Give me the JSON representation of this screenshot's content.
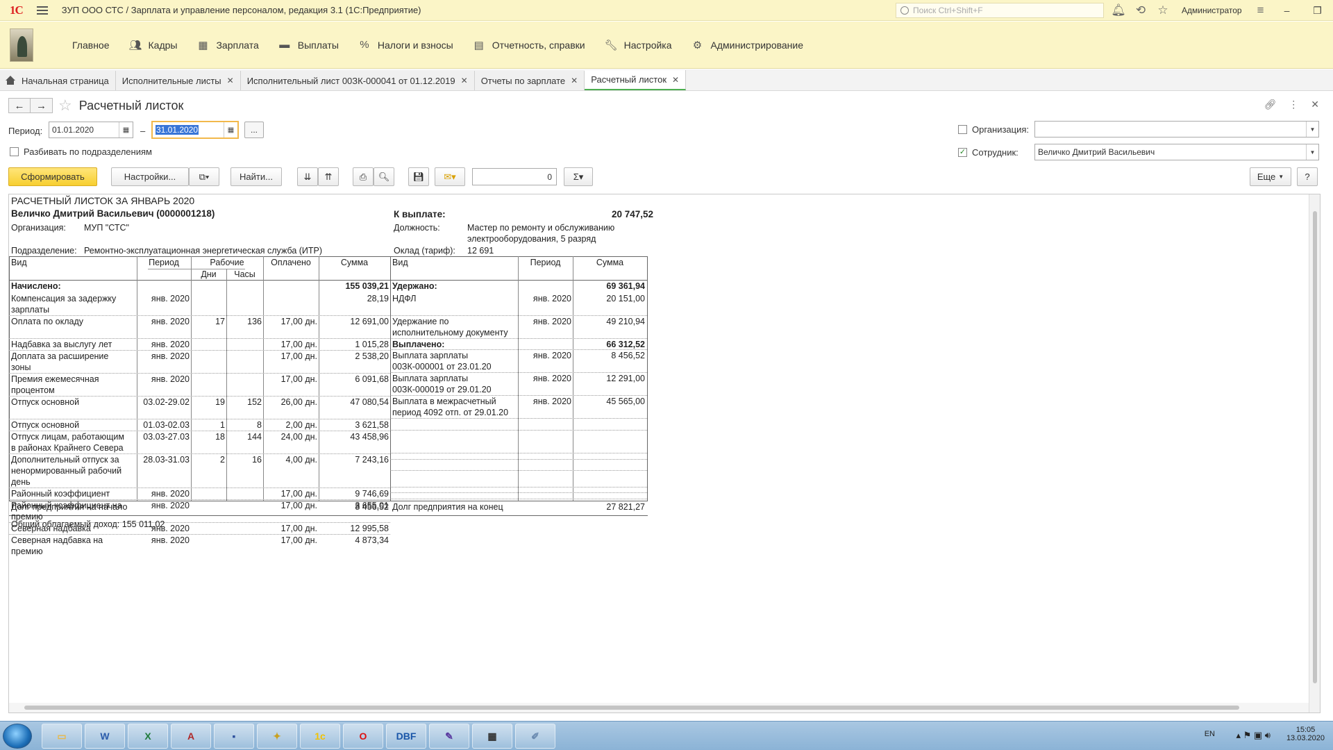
{
  "window": {
    "logo": "1С",
    "title": "ЗУП ООО СТС / Зарплата и управление персоналом, редакция 3.1  (1С:Предприятие)",
    "search_placeholder": "Поиск Ctrl+Shift+F",
    "user": "Администратор",
    "minimize": "–",
    "restore": "❐",
    "close": "✕"
  },
  "menu": {
    "items": [
      {
        "label": "Главное",
        "icon": "home-icon"
      },
      {
        "label": "Кадры",
        "icon": "people-icon"
      },
      {
        "label": "Зарплата",
        "icon": "calculator-icon"
      },
      {
        "label": "Выплаты",
        "icon": "wallet-icon"
      },
      {
        "label": "Налоги и взносы",
        "icon": "percent-icon"
      },
      {
        "label": "Отчетность, справки",
        "icon": "report-icon"
      },
      {
        "label": "Настройка",
        "icon": "wrench-icon"
      },
      {
        "label": "Администрирование",
        "icon": "gear-icon"
      }
    ]
  },
  "tabs": [
    {
      "label": "Начальная страница",
      "closable": false
    },
    {
      "label": "Исполнительные листы",
      "closable": true
    },
    {
      "label": "Исполнительный лист 00ЗК-000041 от 01.12.2019",
      "closable": true
    },
    {
      "label": "Отчеты по зарплате",
      "closable": true
    },
    {
      "label": "Расчетный листок",
      "closable": true,
      "active": true
    }
  ],
  "form": {
    "title": "Расчетный листок",
    "period_label": "Период:",
    "date_from": "01.01.2020",
    "date_to": "31.01.2020",
    "dash": "–",
    "more_button": "...",
    "split_label": "Разбивать по подразделениям",
    "org_label": "Организация:",
    "org_value": "",
    "emp_label": "Сотрудник:",
    "emp_value": "Величко Дмитрий Васильевич",
    "emp_checked": true,
    "org_checked": false
  },
  "toolbar": {
    "generate": "Сформировать",
    "settings": "Настройки...",
    "find": "Найти...",
    "sum_value": "0",
    "more": "Еще",
    "help": "?"
  },
  "report": {
    "title": "РАСЧЕТНЫЙ ЛИСТОК ЗА ЯНВАРЬ 2020",
    "employee": "Величко Дмитрий Васильевич (0000001218)",
    "pay_label": "К выплате:",
    "pay_value": "20 747,52",
    "org_label": "Организация:",
    "org_value": "МУП \"СТС\"",
    "pos_label": "Должность:",
    "pos_line1": "Мастер по ремонту и обслуживанию",
    "pos_line2": "электрооборудования, 5 разряд",
    "dept_label": "Подразделение:",
    "dept_value": "Ремонтно-эксплуатационная энергетическая служба (ИТР)",
    "salary_label": "Оклад (тариф):",
    "salary_value": "12 691",
    "headers": {
      "kind": "Вид",
      "period": "Период",
      "working": "Рабочие",
      "days": "Дни",
      "hours": "Часы",
      "paid": "Оплачено",
      "sum": "Сумма"
    },
    "accrued_label": "Начислено:",
    "accrued_total": "155 039,21",
    "withheld_label": "Удержано:",
    "withheld_total": "69 361,94",
    "paidout_label": "Выплачено:",
    "paidout_total": "66 312,52",
    "accruals": [
      {
        "l1": "Компенсация за задержку",
        "l2": "зарплаты",
        "l3": "",
        "period": "янв. 2020",
        "days": "",
        "hours": "",
        "paid": "",
        "sum": "28,19"
      },
      {
        "l1": "Оплата по окладу",
        "l2": "",
        "l3": "",
        "period": "янв. 2020",
        "days": "17",
        "hours": "136",
        "paid": "17,00 дн.",
        "sum": "12 691,00"
      },
      {
        "l1": "Надбавка за выслугу лет",
        "l2": "",
        "l3": "",
        "period": "янв. 2020",
        "days": "",
        "hours": "",
        "paid": "17,00 дн.",
        "sum": "1 015,28"
      },
      {
        "l1": "Доплата за расширение",
        "l2": "зоны",
        "l3": "",
        "period": "янв. 2020",
        "days": "",
        "hours": "",
        "paid": "17,00 дн.",
        "sum": "2 538,20"
      },
      {
        "l1": "Премия ежемесячная",
        "l2": "процентом",
        "l3": "",
        "period": "янв. 2020",
        "days": "",
        "hours": "",
        "paid": "17,00 дн.",
        "sum": "6 091,68"
      },
      {
        "l1": "Отпуск основной",
        "l2": "",
        "l3": "",
        "period": "03.02-29.02",
        "days": "19",
        "hours": "152",
        "paid": "26,00 дн.",
        "sum": "47 080,54"
      },
      {
        "l1": "Отпуск основной",
        "l2": "",
        "l3": "",
        "period": "01.03-02.03",
        "days": "1",
        "hours": "8",
        "paid": "2,00 дн.",
        "sum": "3 621,58"
      },
      {
        "l1": "Отпуск лицам, работающим",
        "l2": "в районах Крайнего Севера",
        "l3": "",
        "period": "03.03-27.03",
        "days": "18",
        "hours": "144",
        "paid": "24,00 дн.",
        "sum": "43 458,96"
      },
      {
        "l1": "Дополнительный отпуск за",
        "l2": "ненормированный рабочий",
        "l3": "день",
        "period": "28.03-31.03",
        "days": "2",
        "hours": "16",
        "paid": "4,00 дн.",
        "sum": "7 243,16"
      },
      {
        "l1": "Районный коэффициент",
        "l2": "",
        "l3": "",
        "period": "янв. 2020",
        "days": "",
        "hours": "",
        "paid": "17,00 дн.",
        "sum": "9 746,69"
      },
      {
        "l1": "Районный коэффициент на",
        "l2": "премию",
        "l3": "",
        "period": "янв. 2020",
        "days": "",
        "hours": "",
        "paid": "17,00 дн.",
        "sum": "3 655,01"
      },
      {
        "l1": "Северная надбавка",
        "l2": "",
        "l3": "",
        "period": "янв. 2020",
        "days": "",
        "hours": "",
        "paid": "17,00 дн.",
        "sum": "12 995,58"
      },
      {
        "l1": "Северная надбавка на",
        "l2": "премию",
        "l3": "",
        "period": "янв. 2020",
        "days": "",
        "hours": "",
        "paid": "17,00 дн.",
        "sum": "4 873,34"
      }
    ],
    "right": [
      {
        "l1": "НДФЛ",
        "l2": "",
        "period": "янв. 2020",
        "sum": "20 151,00"
      },
      {
        "l1": "Удержание по",
        "l2": "исполнительному документу",
        "period": "янв. 2020",
        "sum": "49 210,94"
      },
      {
        "l1": "Выплата зарплаты",
        "l2": "00ЗК-000001 от 23.01.20",
        "period": "янв. 2020",
        "sum": "8 456,52"
      },
      {
        "l1": "Выплата зарплаты",
        "l2": "00ЗК-000019 от 29.01.20",
        "period": "янв. 2020",
        "sum": "12 291,00"
      },
      {
        "l1": "Выплата в межрасчетный",
        "l2": "период 4092 отп. от 29.01.20",
        "period": "янв. 2020",
        "sum": "45 565,00"
      }
    ],
    "debt_start_label": "Долг предприятия на начало",
    "debt_start": "8 456,52",
    "debt_end_label": "Долг предприятия на конец",
    "debt_end": "27 821,27",
    "taxable_income": "Общий облагаемый доход: 155 011,02"
  },
  "taskbar": {
    "apps": [
      "Проводник",
      "Word",
      "Excel",
      "Access",
      "Сохранить",
      "Налогоплательщик ЮЛ",
      "1С",
      "Opera",
      "DBF Plus",
      "Visual Studio",
      "Монитор",
      "Paint"
    ],
    "lang": "EN",
    "time": "15:05",
    "date": "13.03.2020"
  }
}
